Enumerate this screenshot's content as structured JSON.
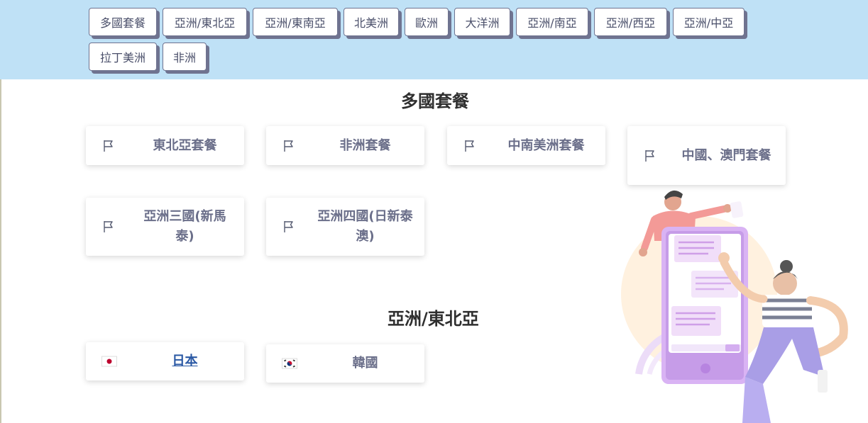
{
  "region_nav": [
    {
      "label": "多國套餐"
    },
    {
      "label": "亞洲/東北亞"
    },
    {
      "label": "亞洲/東南亞"
    },
    {
      "label": "北美洲"
    },
    {
      "label": "歐洲"
    },
    {
      "label": "大洋洲"
    },
    {
      "label": "亞洲/南亞"
    },
    {
      "label": "亞洲/西亞"
    },
    {
      "label": "亞洲/中亞"
    },
    {
      "label": "拉丁美洲"
    },
    {
      "label": "非洲"
    }
  ],
  "sections": [
    {
      "title": "多國套餐",
      "cards": [
        {
          "label": "東北亞套餐",
          "icon": "flag-outline-icon"
        },
        {
          "label": "非洲套餐",
          "icon": "flag-outline-icon"
        },
        {
          "label": "中南美洲套餐",
          "icon": "flag-outline-icon"
        },
        {
          "label": "中國、澳門套餐",
          "icon": "flag-outline-icon"
        },
        {
          "label": "亞洲三國(新馬泰)",
          "icon": "flag-outline-icon"
        },
        {
          "label": "亞洲四國(日新泰澳)",
          "icon": "flag-outline-icon"
        }
      ]
    },
    {
      "title": "亞洲/東北亞",
      "cards": [
        {
          "label": "日本",
          "icon": "japan-flag-icon"
        },
        {
          "label": "韓國",
          "icon": "korea-flag-icon"
        }
      ]
    }
  ],
  "colors": {
    "nav_background": "#bfe1f6",
    "button_border": "#6f7390",
    "card_text": "#6b6f8a",
    "link_text": "#2a58a4"
  }
}
